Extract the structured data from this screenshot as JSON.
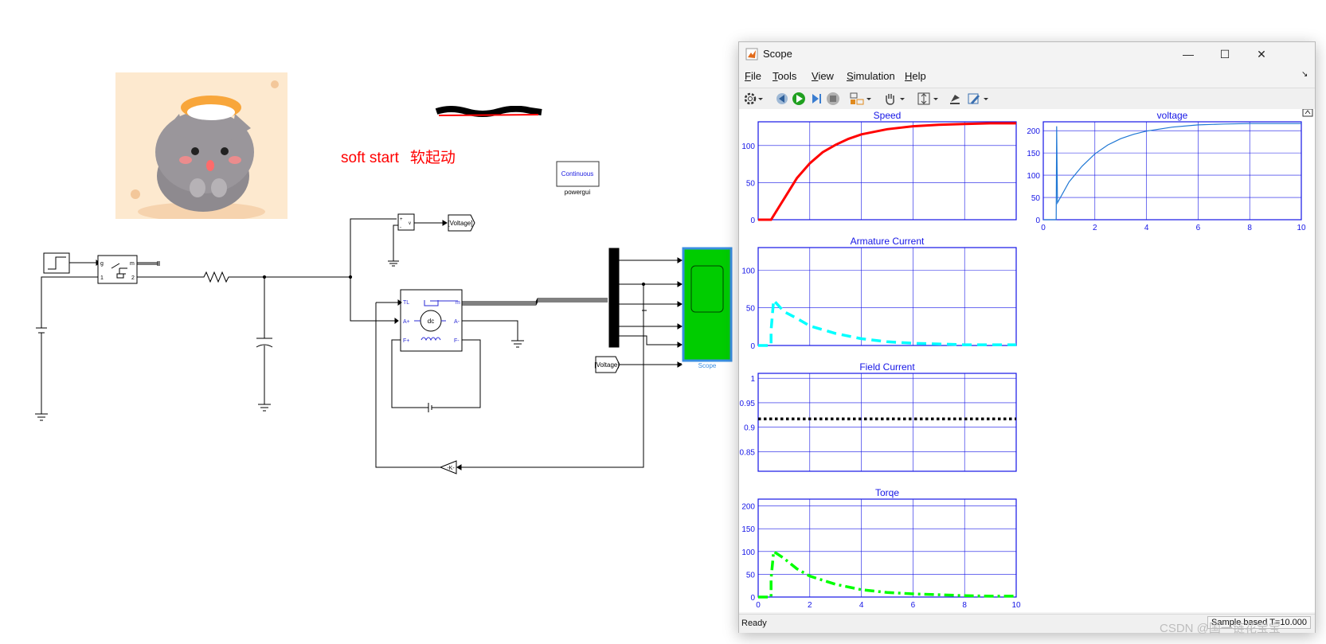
{
  "model": {
    "annotation_en": "soft start",
    "annotation_cn": "软起动",
    "powergui": {
      "mode": "Continuous",
      "label": "powergui"
    },
    "goto_label": "[Voltage]",
    "from_label": "[Voltage]",
    "scope_label": "Scope",
    "gain_label": "-K-",
    "machine": {
      "label": "dc",
      "ports": {
        "tl": "TL",
        "m": "m",
        "a_plus": "A+",
        "a_minus": "A-",
        "f_plus": "F+",
        "f_minus": "F-"
      }
    },
    "switch_ports": {
      "g": "g",
      "m": "m",
      "p1": "1",
      "p2": "2"
    },
    "vmeter_ports": {
      "plus": "+",
      "minus": "-",
      "v": "v"
    }
  },
  "scope_window": {
    "title": "Scope",
    "controls": {
      "minimize": "—",
      "maximize": "☐",
      "close": "✕"
    },
    "menu": [
      {
        "key": "F",
        "rest": "ile"
      },
      {
        "key": "T",
        "rest": "ools"
      },
      {
        "key": "V",
        "rest": "iew"
      },
      {
        "key": "S",
        "rest": "imulation"
      },
      {
        "key": "H",
        "rest": "elp"
      }
    ],
    "toolbar_icons": [
      "gear-icon",
      "dropdown-icon",
      "step-back-icon",
      "run-icon",
      "step-forward-icon",
      "stop-icon",
      "layout-icon",
      "dropdown-icon",
      "pan-icon",
      "dropdown-icon",
      "autoscale-icon",
      "dropdown-icon",
      "cursor-icon",
      "edit-icon",
      "dropdown-icon"
    ],
    "status": {
      "left": "Ready",
      "right": "Sample based  T=10.000"
    }
  },
  "chart_data": [
    {
      "type": "line",
      "title": "Speed",
      "xlim": [
        0,
        10
      ],
      "ylim": [
        0,
        132
      ],
      "yticks": [
        0,
        50,
        100
      ],
      "xticks": [],
      "series": [
        {
          "color": "#ff0000",
          "style": "solid",
          "width": 3,
          "x": [
            0,
            0.5,
            1,
            1.5,
            2,
            2.5,
            3,
            3.5,
            4,
            5,
            6,
            7,
            8,
            9,
            10
          ],
          "y": [
            0,
            0,
            28,
            56,
            76,
            91,
            101,
            109,
            115,
            122,
            126,
            128,
            129,
            130,
            130
          ]
        }
      ]
    },
    {
      "type": "line",
      "title": "voltage",
      "xlim": [
        0,
        10
      ],
      "ylim": [
        0,
        220
      ],
      "yticks": [
        0,
        50,
        100,
        150,
        200
      ],
      "xticks": [
        0,
        2,
        4,
        6,
        8,
        10
      ],
      "series": [
        {
          "color": "#1f77d4",
          "style": "solid",
          "width": 1.2,
          "x": [
            0,
            0.5,
            0.5,
            0.52,
            0.55,
            1,
            1.5,
            2,
            2.5,
            3,
            3.5,
            4,
            5,
            6,
            7,
            8,
            9,
            10
          ],
          "y": [
            0,
            0,
            0,
            210,
            38,
            85,
            120,
            148,
            168,
            182,
            192,
            199,
            208,
            213,
            215,
            216,
            216,
            216
          ]
        }
      ]
    },
    {
      "type": "line",
      "title": "Armature Current",
      "xlim": [
        0,
        10
      ],
      "ylim": [
        0,
        130
      ],
      "yticks": [
        0,
        50,
        100
      ],
      "xticks": [],
      "series": [
        {
          "color": "#00ffff",
          "style": "dashed",
          "width": 3.5,
          "x": [
            0,
            0.5,
            0.5,
            0.6,
            1,
            1.5,
            2,
            3,
            4,
            5,
            6,
            7,
            8,
            9,
            10
          ],
          "y": [
            0,
            0,
            20,
            60,
            45,
            36,
            26,
            16,
            9,
            5,
            3,
            2,
            1,
            1,
            1
          ]
        }
      ]
    },
    {
      "type": "line",
      "title": "Field Current",
      "xlim": [
        0,
        10
      ],
      "ylim": [
        0.81,
        1.01
      ],
      "yticks": [
        0.85,
        0.9,
        0.95,
        1
      ],
      "xticks": [],
      "series": [
        {
          "color": "#000000",
          "style": "dotted",
          "width": 3.5,
          "x": [
            0,
            10
          ],
          "y": [
            0.917,
            0.917
          ]
        }
      ]
    },
    {
      "type": "line",
      "title": "Torqe",
      "xlim": [
        0,
        10
      ],
      "ylim": [
        0,
        215
      ],
      "yticks": [
        0,
        50,
        100,
        150,
        200
      ],
      "xticks": [
        0,
        2,
        4,
        6,
        8,
        10
      ],
      "series": [
        {
          "color": "#00ff00",
          "style": "dashdot",
          "width": 3.5,
          "x": [
            0,
            0.5,
            0.5,
            0.6,
            1,
            1.5,
            2,
            3,
            4,
            5,
            6,
            7,
            8,
            9,
            10
          ],
          "y": [
            0,
            0,
            40,
            100,
            85,
            62,
            46,
            28,
            16,
            10,
            7,
            5,
            3,
            2,
            2
          ]
        }
      ]
    }
  ],
  "watermark": "CSDN @国一链花宝宝"
}
